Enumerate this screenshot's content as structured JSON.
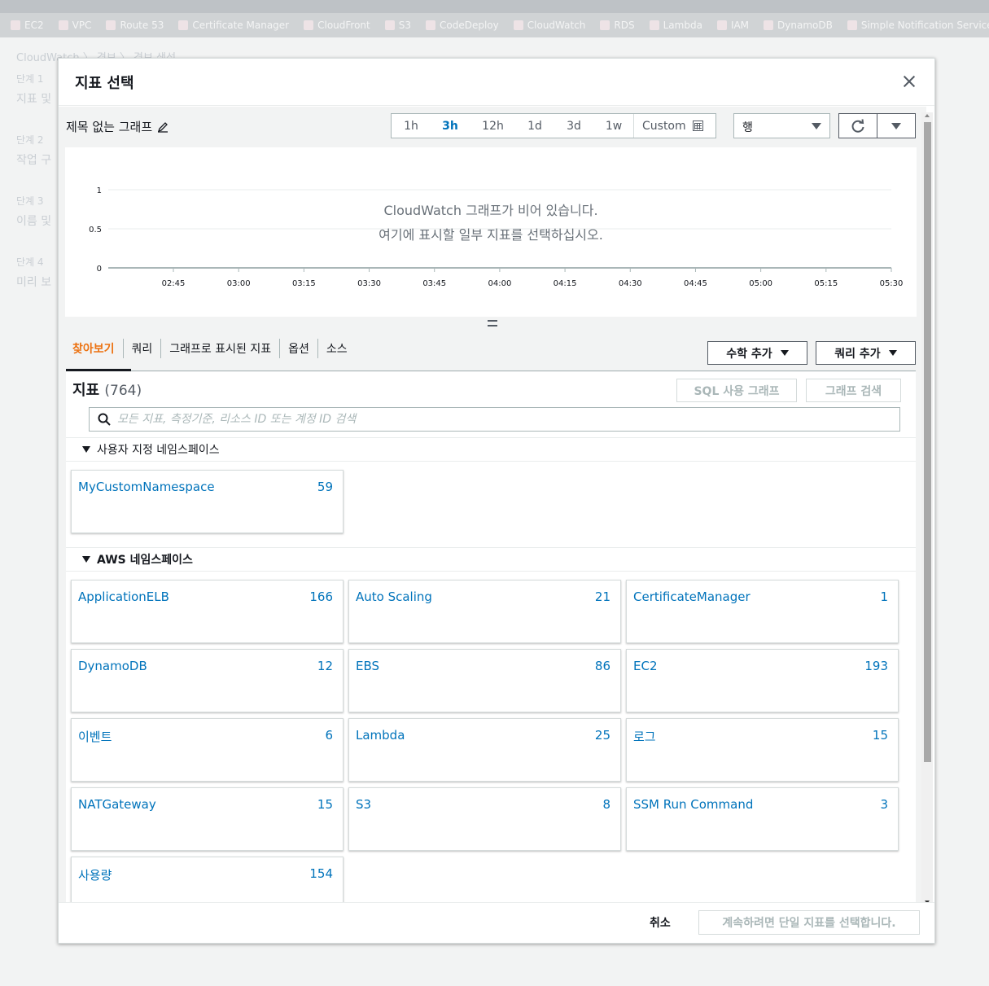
{
  "favorites": [
    "EC2",
    "VPC",
    "Route 53",
    "Certificate Manager",
    "CloudFront",
    "S3",
    "CodeDeploy",
    "CloudWatch",
    "RDS",
    "Lambda",
    "IAM",
    "DynamoDB",
    "Simple Notification Service"
  ],
  "background": {
    "breadcrumb": "CloudWatch  〉 경보  〉 경보 생성",
    "steps": [
      {
        "step": "단계 1",
        "label": "지표 및"
      },
      {
        "step": "단계 2",
        "label": "작업 구"
      },
      {
        "step": "단계 3",
        "label": "이름 및"
      },
      {
        "step": "단계 4",
        "label": "미리 보"
      }
    ]
  },
  "modal": {
    "title": "지표 선택",
    "graph_title": "제목 없는 그래프",
    "time_ranges": [
      "1h",
      "3h",
      "12h",
      "1d",
      "3d",
      "1w"
    ],
    "active_range": "3h",
    "custom_label": "Custom",
    "graph_type": "행",
    "empty_line1": "CloudWatch 그래프가 비어 있습니다.",
    "empty_line2": "여기에 표시할 일부 지표를 선택하십시오.",
    "y_ticks": [
      "1",
      "0.5",
      "0"
    ],
    "x_ticks": [
      "02:45",
      "03:00",
      "03:15",
      "03:30",
      "03:45",
      "04:00",
      "04:15",
      "04:30",
      "04:45",
      "05:00",
      "05:15",
      "05:30"
    ],
    "tabs": [
      "찾아보기",
      "쿼리",
      "그래프로 표시된 지표",
      "옵션",
      "소스"
    ],
    "add_math": "수학 추가",
    "add_query": "쿼리 추가",
    "metrics_label": "지표",
    "metrics_count": "(764)",
    "sql_graph": "SQL 사용 그래프",
    "graph_search": "그래프 검색",
    "search_placeholder": "모든 지표, 측정기준, 리소스 ID 또는 계정 ID 검색",
    "custom_ns_header": "사용자 지정 네임스페이스",
    "custom_namespaces": [
      {
        "name": "MyCustomNamespace",
        "count": "59"
      }
    ],
    "aws_ns_header": "AWS 네임스페이스",
    "aws_namespaces": [
      {
        "name": "ApplicationELB",
        "count": "166"
      },
      {
        "name": "Auto Scaling",
        "count": "21"
      },
      {
        "name": "CertificateManager",
        "count": "1"
      },
      {
        "name": "DynamoDB",
        "count": "12"
      },
      {
        "name": "EBS",
        "count": "86"
      },
      {
        "name": "EC2",
        "count": "193"
      },
      {
        "name": "이벤트",
        "count": "6"
      },
      {
        "name": "Lambda",
        "count": "25"
      },
      {
        "name": "로그",
        "count": "15"
      },
      {
        "name": "NATGateway",
        "count": "15"
      },
      {
        "name": "S3",
        "count": "8"
      },
      {
        "name": "SSM Run Command",
        "count": "3"
      },
      {
        "name": "사용량",
        "count": "154"
      }
    ],
    "cancel": "취소",
    "continue": "계속하려면 단일 지표를 선택합니다."
  }
}
